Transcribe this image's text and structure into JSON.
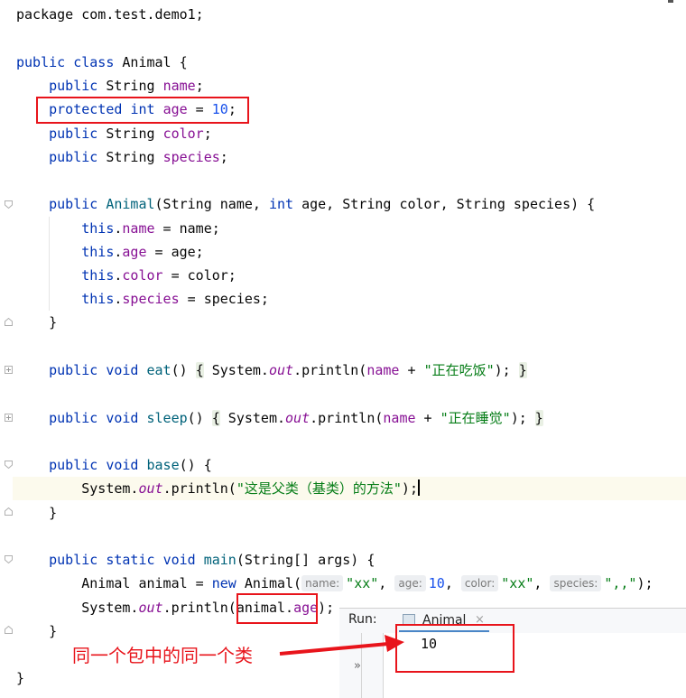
{
  "code": {
    "line01": {
      "t1": "package com.test.demo1;"
    },
    "line03": {
      "kw1": "public",
      "kw2": "class",
      "name": "Animal {"
    },
    "line04": {
      "kw1": "public",
      "type": "String",
      "field": "name",
      "end": ";"
    },
    "line05": {
      "kw1": "protected",
      "kw2": "int",
      "field": "age",
      "eq": " = ",
      "num": "10",
      "end": ";"
    },
    "line06": {
      "kw1": "public",
      "type": "String",
      "field": "color",
      "end": ";"
    },
    "line07": {
      "kw1": "public",
      "type": "String",
      "field": "species",
      "end": ";"
    },
    "line09": {
      "kw1": "public",
      "method": "Animal",
      "p1": "(String name, ",
      "kw2": "int",
      "p2": " age, String color, String species) {"
    },
    "line10": {
      "kw": "this",
      "dot": ".",
      "field": "name",
      "rest": " = name;"
    },
    "line11": {
      "kw": "this",
      "dot": ".",
      "field": "age",
      "rest": " = age;"
    },
    "line12": {
      "kw": "this",
      "dot": ".",
      "field": "color",
      "rest": " = color;"
    },
    "line13": {
      "kw": "this",
      "dot": ".",
      "field": "species",
      "rest": " = species;"
    },
    "line14": {
      "t": "}"
    },
    "line16": {
      "kw1": "public",
      "kw2": "void",
      "method": "eat",
      "paren": "()",
      "open": "{",
      "call": " System.",
      "out": "out",
      "println": ".println(",
      "field": "name",
      "plus": " + ",
      "str": "\"正在吃饭\"",
      "close": ");",
      "brace": "}"
    },
    "line18": {
      "kw1": "public",
      "kw2": "void",
      "method": "sleep",
      "paren": "()",
      "open": "{",
      "call": " System.",
      "out": "out",
      "println": ".println(",
      "field": "name",
      "plus": " + ",
      "str": "\"正在睡觉\"",
      "close": ");",
      "brace": "}"
    },
    "line20": {
      "kw1": "public",
      "kw2": "void",
      "method": "base",
      "rest": "() {"
    },
    "line21": {
      "call": "System.",
      "out": "out",
      "println": ".println(",
      "str": "\"这是父类（基类）的方法\"",
      "close": ");"
    },
    "line22": {
      "t": "}"
    },
    "line24": {
      "kw1": "public",
      "kw2": "static",
      "kw3": "void",
      "method": "main",
      "rest": "(String[] args) {"
    },
    "line25": {
      "decl": "Animal animal = ",
      "kw": "new",
      "ctor": " Animal(",
      "h1": "name:",
      "s1": "\"xx\"",
      "c1": ", ",
      "h2": "age:",
      "n1": "10",
      "c2": ", ",
      "h3": "color:",
      "s2": "\"xx\"",
      "c3": ", ",
      "h4": "species:",
      "s3": "\",,\"",
      "close": ");"
    },
    "line26": {
      "call": "System.",
      "out": "out",
      "println": ".println(",
      "var": "animal.",
      "field": "age",
      "close": ");"
    },
    "line27": {
      "t": "}"
    },
    "line29": {
      "t": "}"
    }
  },
  "run": {
    "label": "Run:",
    "tab": "Animal",
    "close_glyph": "×",
    "output": "10",
    "chevron": "»"
  },
  "annotation": {
    "text": "同一个包中的同一个类",
    "color": "#e8141b"
  }
}
